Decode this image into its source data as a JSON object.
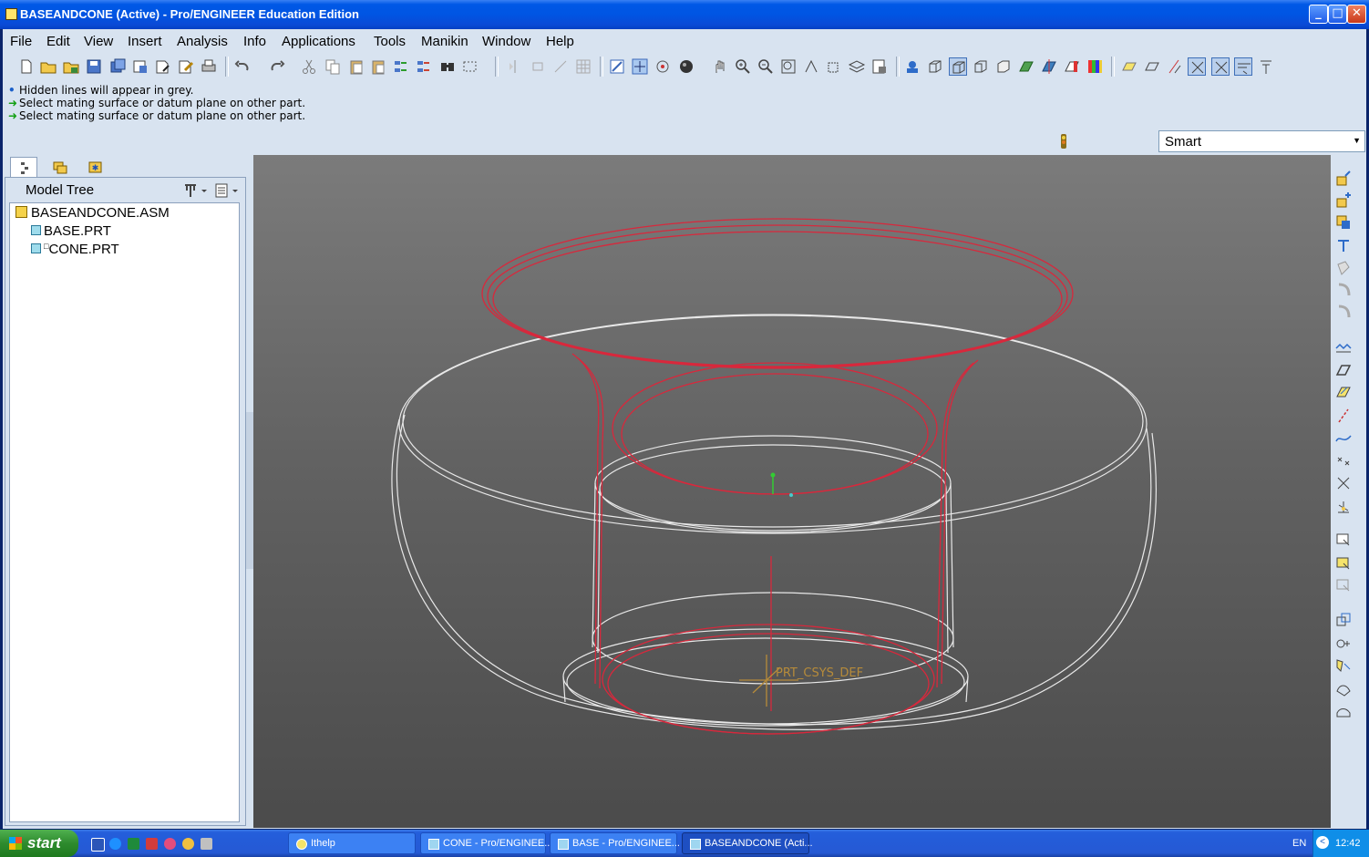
{
  "window": {
    "title": "BASEANDCONE (Active) - Pro/ENGINEER Education Edition"
  },
  "menubar": [
    "File",
    "Edit",
    "View",
    "Insert",
    "Analysis",
    "Info",
    "Applications",
    "Tools",
    "Manikin",
    "Window",
    "Help"
  ],
  "messages": [
    {
      "kind": "info",
      "text": "Hidden lines will appear in grey."
    },
    {
      "kind": "prompt",
      "text": "Select mating surface or datum plane on other part."
    },
    {
      "kind": "prompt",
      "text": "Select mating surface or datum plane on other part."
    }
  ],
  "filter": {
    "value": "Smart"
  },
  "model_tree": {
    "header": "Model Tree",
    "items": [
      {
        "label": "BASEANDCONE.ASM",
        "type": "assembly"
      },
      {
        "label": "BASE.PRT",
        "type": "part"
      },
      {
        "label": "CONE.PRT",
        "type": "part",
        "prefix": "□"
      }
    ]
  },
  "viewport": {
    "csys_label": "PRT_CSYS_DEF"
  },
  "taskbar": {
    "start_label": "start",
    "tasks": [
      "Ithelp",
      "CONE - Pro/ENGINEE...",
      "BASE - Pro/ENGINEE...",
      "BASEANDCONE (Acti..."
    ],
    "language": "EN",
    "clock": "12:42"
  },
  "colors": {
    "accent": "#0a4ad6",
    "part_edges": "#d8283c",
    "grey_edges": "#e6e6e6"
  }
}
